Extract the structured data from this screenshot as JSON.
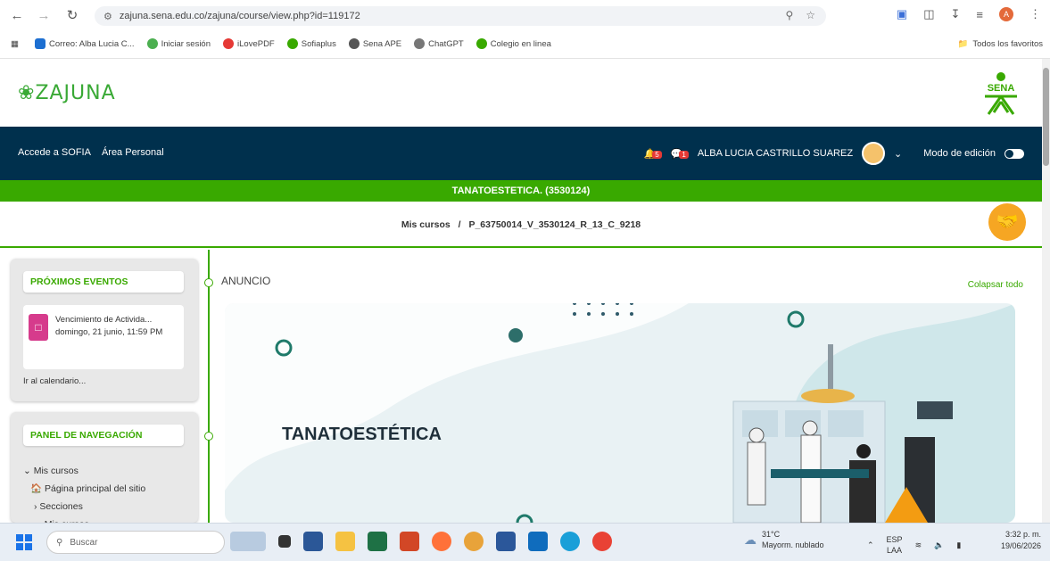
{
  "browser": {
    "url": "zajuna.sena.edu.co/zajuna/course/view.php?id=119172",
    "bookmarks": [
      "Correo: Alba Lucia C...",
      "Iniciar sesión",
      "iLovePDF",
      "Sofiaplus",
      "Sena APE",
      "ChatGPT",
      "Colegio en linea"
    ],
    "favorites_label": "Todos los favoritos",
    "profile_initial": "A"
  },
  "header": {
    "logo_text": "ZAJUNA",
    "sena_text": "SENA"
  },
  "navbar": {
    "links": [
      "Accede a SOFIA",
      "Área Personal"
    ],
    "user_name": "ALBA LUCIA CASTRILLO SUAREZ",
    "edit_mode_label": "Modo de edición",
    "notifications_badge": "5",
    "messages_badge": "1"
  },
  "course": {
    "title": "TANATOESTETICA. (3530124)",
    "breadcrumb_root": "Mis cursos",
    "breadcrumb_sep": "/",
    "breadcrumb_current": "P_63750014_V_3530124_R_13_C_9218"
  },
  "sidebar": {
    "events_title": "PRÓXIMOS EVENTOS",
    "event_name": "Vencimiento de Activida...",
    "event_date": "domingo, 21 junio, 11:59 PM",
    "calendar_link": "Ir al calendario...",
    "nav_title": "PANEL DE NAVEGACIÓN",
    "nav_items": [
      "Mis cursos",
      "Página principal del sitio",
      "Secciones",
      "Mis cursos"
    ]
  },
  "main": {
    "section_label": "ANUNCIO",
    "collapse_label": "Colapsar todo",
    "banner_title": "TANATOESTÉTICA"
  },
  "taskbar": {
    "search_placeholder": "Buscar",
    "temperature": "31°C",
    "weather_desc": "Mayorm. nublado",
    "lang": "ESP",
    "lang_sub": "LAA",
    "time": "3:32 p. m.",
    "date": "19/06/2026"
  }
}
